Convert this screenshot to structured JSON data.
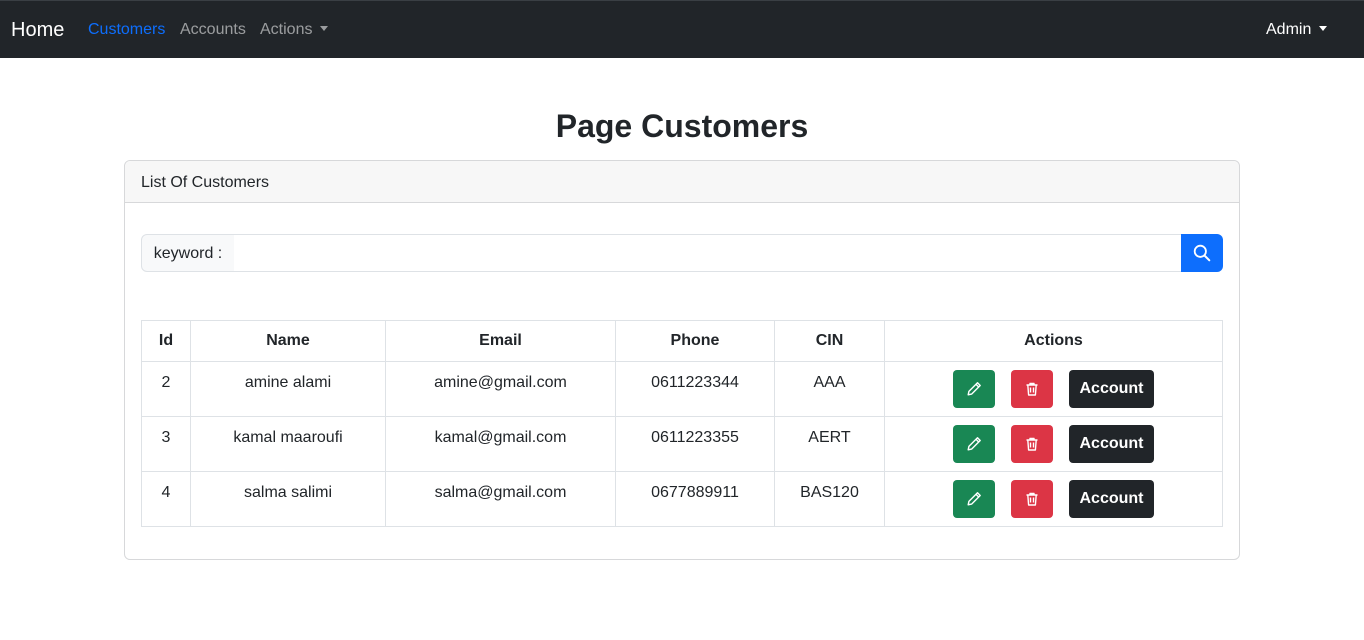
{
  "navbar": {
    "brand": "Home",
    "links": [
      {
        "label": "Customers",
        "active": true
      },
      {
        "label": "Accounts",
        "active": false
      },
      {
        "label": "Actions",
        "dropdown": true
      }
    ],
    "user_menu": "Admin"
  },
  "page": {
    "title": "Page Customers"
  },
  "card": {
    "header": "List Of Customers",
    "search": {
      "label": "keyword :",
      "value": "",
      "button_icon": "search-icon"
    },
    "table": {
      "columns": [
        "Id",
        "Name",
        "Email",
        "Phone",
        "CIN",
        "Actions"
      ],
      "rows": [
        {
          "id": "2",
          "name": "amine alami",
          "email": "amine@gmail.com",
          "phone": "0611223344",
          "cin": "AAA"
        },
        {
          "id": "3",
          "name": "kamal maaroufi",
          "email": "kamal@gmail.com",
          "phone": "0611223355",
          "cin": "AERT"
        },
        {
          "id": "4",
          "name": "salma salimi",
          "email": "salma@gmail.com",
          "phone": "0677889911",
          "cin": "BAS120"
        }
      ],
      "action_buttons": {
        "edit_icon": "pencil-icon",
        "delete_icon": "trash-icon",
        "account_label": "Account"
      }
    }
  },
  "colors": {
    "navbar": "#212529",
    "active_link": "#0d6efd",
    "edit": "#198754",
    "delete": "#dc3545",
    "account": "#212529",
    "search_button": "#0d6efd"
  }
}
